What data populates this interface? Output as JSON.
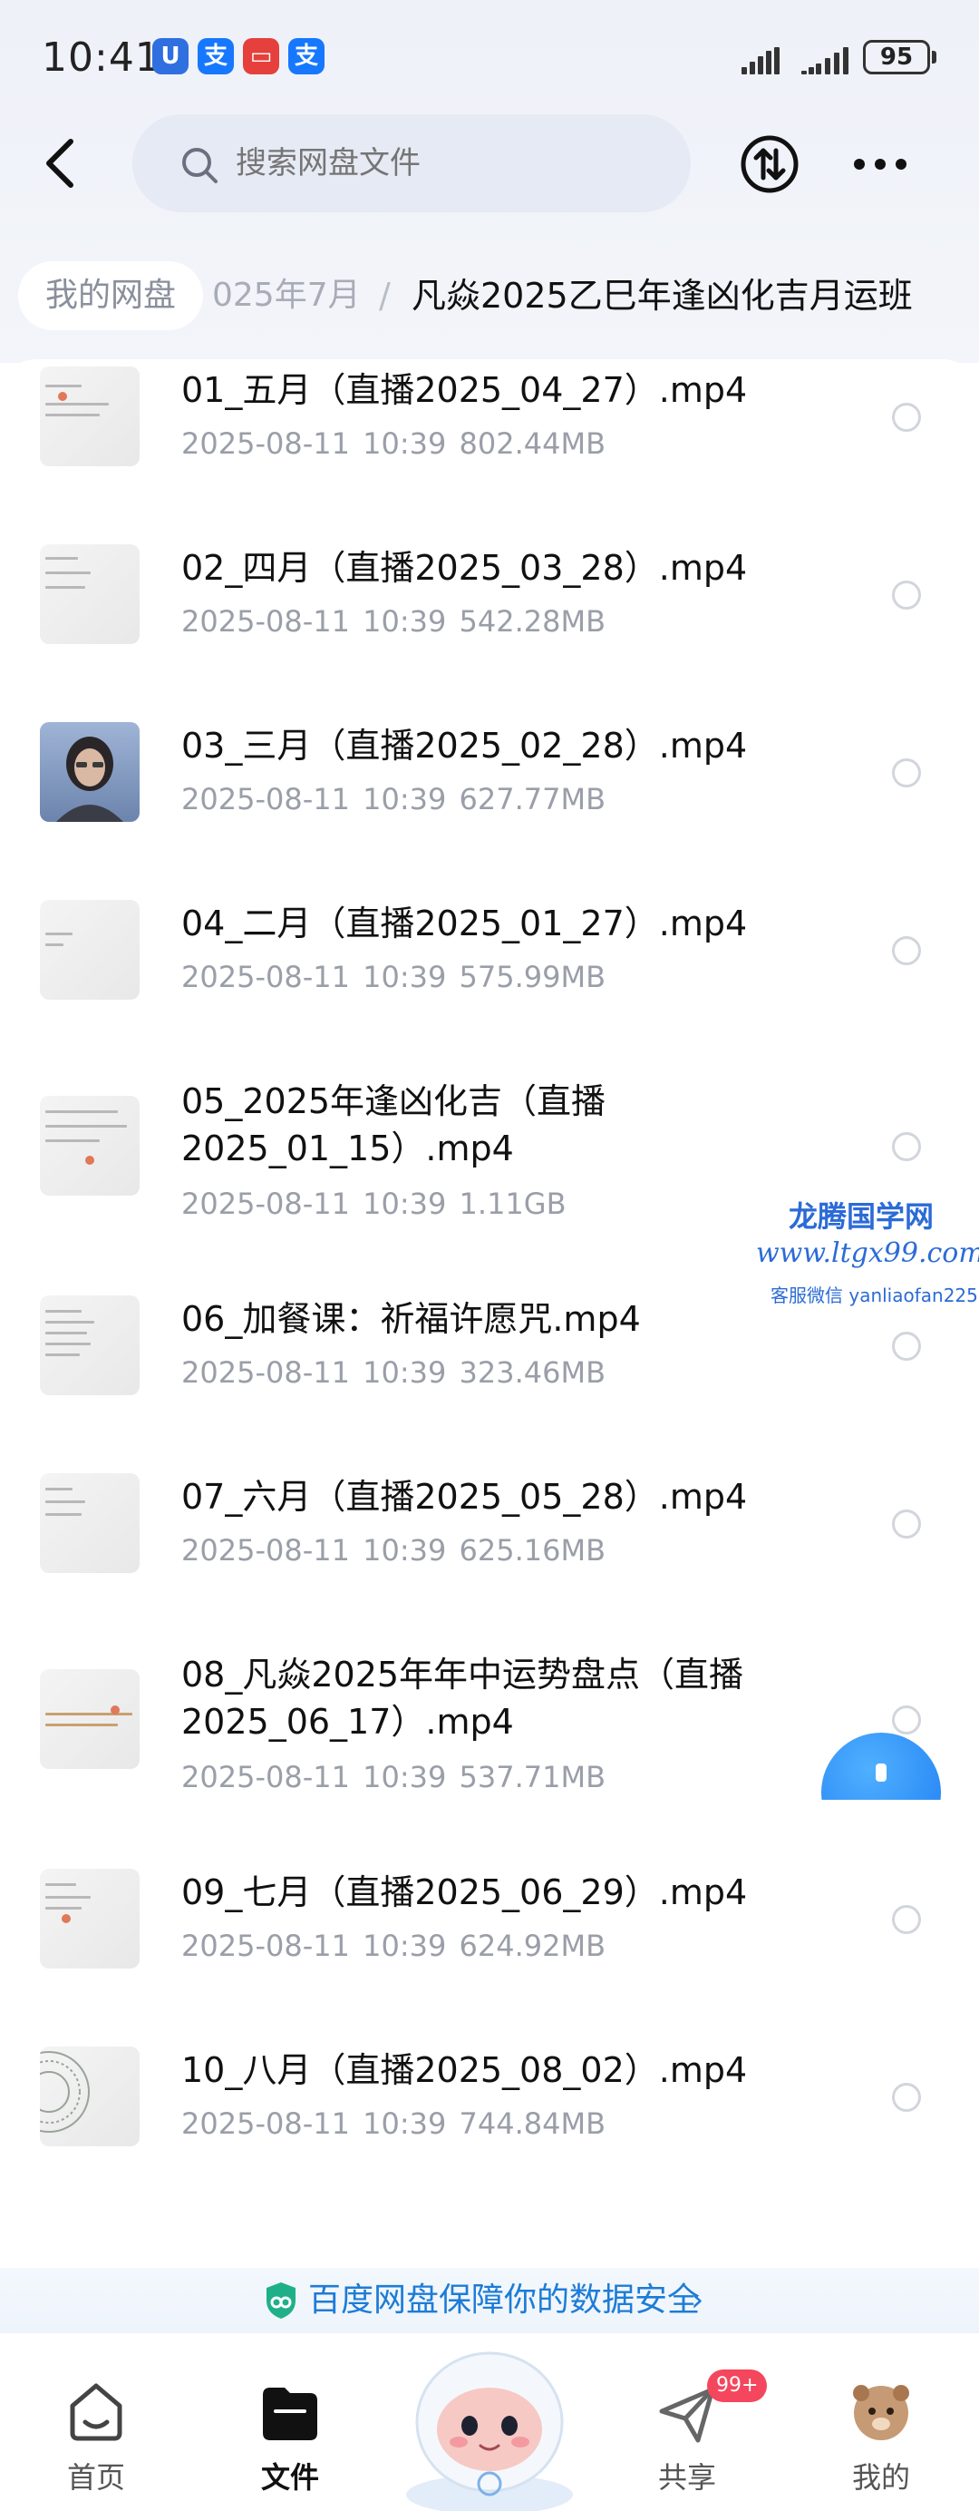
{
  "status_bar": {
    "time": "10:41",
    "battery": "95",
    "app_icons": [
      {
        "name": "security-app-icon",
        "glyph": "U",
        "color": "#2f6fe0"
      },
      {
        "name": "alipay-icon",
        "glyph": "支",
        "color": "#1677ff"
      },
      {
        "name": "message-app-icon",
        "glyph": "▭",
        "color": "#e5403c"
      },
      {
        "name": "alipay-icon-2",
        "glyph": "支",
        "color": "#1677ff"
      }
    ]
  },
  "header": {
    "search_placeholder": "搜索网盘文件"
  },
  "breadcrumb": {
    "home": "我的网盘",
    "middle": "025年7月",
    "separator": "/",
    "current": "凡焱2025乙巳年逢凶化吉月运班"
  },
  "files": [
    {
      "name": "01_五月（直播2025_04_27）.mp4",
      "date": "2025-08-11",
      "time": "10:39",
      "size": "802.44MB",
      "thumb": "doc"
    },
    {
      "name": "02_四月（直播2025_03_28）.mp4",
      "date": "2025-08-11",
      "time": "10:39",
      "size": "542.28MB",
      "thumb": "doc"
    },
    {
      "name": "03_三月（直播2025_02_28）.mp4",
      "date": "2025-08-11",
      "time": "10:39",
      "size": "627.77MB",
      "thumb": "person"
    },
    {
      "name": "04_二月（直播2025_01_27）.mp4",
      "date": "2025-08-11",
      "time": "10:39",
      "size": "575.99MB",
      "thumb": "doc"
    },
    {
      "name": "05_2025年逢凶化吉（直播2025_01_15）.mp4",
      "date": "2025-08-11",
      "time": "10:39",
      "size": "1.11GB",
      "thumb": "doc"
    },
    {
      "name": "06_加餐课：祈福许愿咒.mp4",
      "date": "2025-08-11",
      "time": "10:39",
      "size": "323.46MB",
      "thumb": "doc"
    },
    {
      "name": "07_六月（直播2025_05_28）.mp4",
      "date": "2025-08-11",
      "time": "10:39",
      "size": "625.16MB",
      "thumb": "doc"
    },
    {
      "name": "08_凡焱2025年年中运势盘点（直播2025_06_17）.mp4",
      "date": "2025-08-11",
      "time": "10:39",
      "size": "537.71MB",
      "thumb": "doc"
    },
    {
      "name": "09_七月（直播2025_06_29）.mp4",
      "date": "2025-08-11",
      "time": "10:39",
      "size": "624.92MB",
      "thumb": "doc"
    },
    {
      "name": "10_八月（直播2025_08_02）.mp4",
      "date": "2025-08-11",
      "time": "10:39",
      "size": "744.84MB",
      "thumb": "chart"
    }
  ],
  "watermark": {
    "line1": "龙腾国学网",
    "line2": "www.ltgx99.com",
    "line3": "客服微信 yanliaofan225"
  },
  "security_banner": {
    "text": "百度网盘保障你的数据安全",
    "chevron": "›"
  },
  "bottom_nav": {
    "items": [
      {
        "label": "首页",
        "icon": "home-icon",
        "active": false
      },
      {
        "label": "文件",
        "icon": "folder-icon",
        "active": true
      },
      {
        "label": "共享",
        "icon": "share-icon",
        "active": false
      },
      {
        "label": "我的",
        "icon": "avatar-icon",
        "active": false
      }
    ],
    "share_badge": "99+"
  },
  "colors": {
    "accent": "#1d7cd6",
    "badge": "#f4465c"
  }
}
